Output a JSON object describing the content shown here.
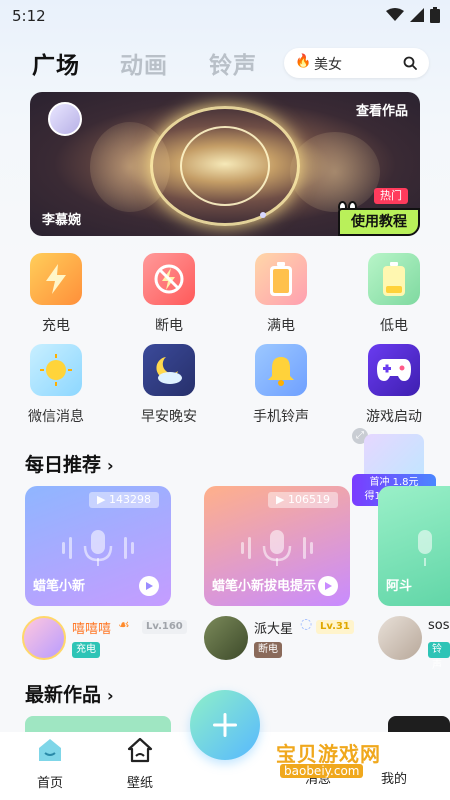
{
  "status_bar": {
    "time": "5:12"
  },
  "top_tabs": [
    {
      "label": "广场",
      "active": true
    },
    {
      "label": "动画",
      "active": false
    },
    {
      "label": "铃声",
      "active": false
    }
  ],
  "search": {
    "query": "美女"
  },
  "banner": {
    "view_label": "查看作品",
    "author": "李慕婉",
    "hot_badge": "热门",
    "tutorial_label": "使用教程"
  },
  "features": [
    {
      "label": "充电",
      "icon": "lightning-icon",
      "color": "#ffa33a"
    },
    {
      "label": "断电",
      "icon": "no-power-icon",
      "color": "#ff6b6b"
    },
    {
      "label": "满电",
      "icon": "full-battery-icon",
      "color": "#ffb36b"
    },
    {
      "label": "低电",
      "icon": "low-battery-icon",
      "color": "#8fe0a8"
    },
    {
      "label": "微信消息",
      "icon": "sun-message-icon",
      "color": "#7fd6ff"
    },
    {
      "label": "早安晚安",
      "icon": "moon-cloud-icon",
      "color": "#2f3a7a"
    },
    {
      "label": "手机铃声",
      "icon": "bell-icon",
      "color": "#6fa9ff"
    },
    {
      "label": "游戏启动",
      "icon": "gamepad-icon",
      "color": "#5a2fd6"
    }
  ],
  "daily": {
    "title": "每日推荐",
    "cards": [
      {
        "name": "蜡笔小新",
        "plays": "143298"
      },
      {
        "name": "蜡笔小新拔电提示",
        "plays": "106519"
      },
      {
        "name": "阿斗",
        "plays": ""
      }
    ],
    "users": [
      {
        "name": "嘻嘻嘻",
        "level": "Lv.160",
        "tag": "充电"
      },
      {
        "name": "派大星",
        "level": "Lv.31",
        "tag": "断电"
      },
      {
        "name": "soso",
        "level": "",
        "tag": "铃声"
      }
    ]
  },
  "float_ad": {
    "line1": "首冲 1.8元",
    "line2": "得100泡泡币"
  },
  "newest": {
    "title": "最新作品"
  },
  "bottom_nav": [
    {
      "label": "首页"
    },
    {
      "label": "壁纸"
    },
    {
      "label": "消息"
    },
    {
      "label": "我的"
    }
  ],
  "watermark": {
    "title": "宝贝游戏网",
    "url": "baobeiy.com"
  },
  "colors": {
    "accent": "#57b8ff",
    "hot": "#ff3b5c",
    "tutorial": "#b9f05a"
  }
}
